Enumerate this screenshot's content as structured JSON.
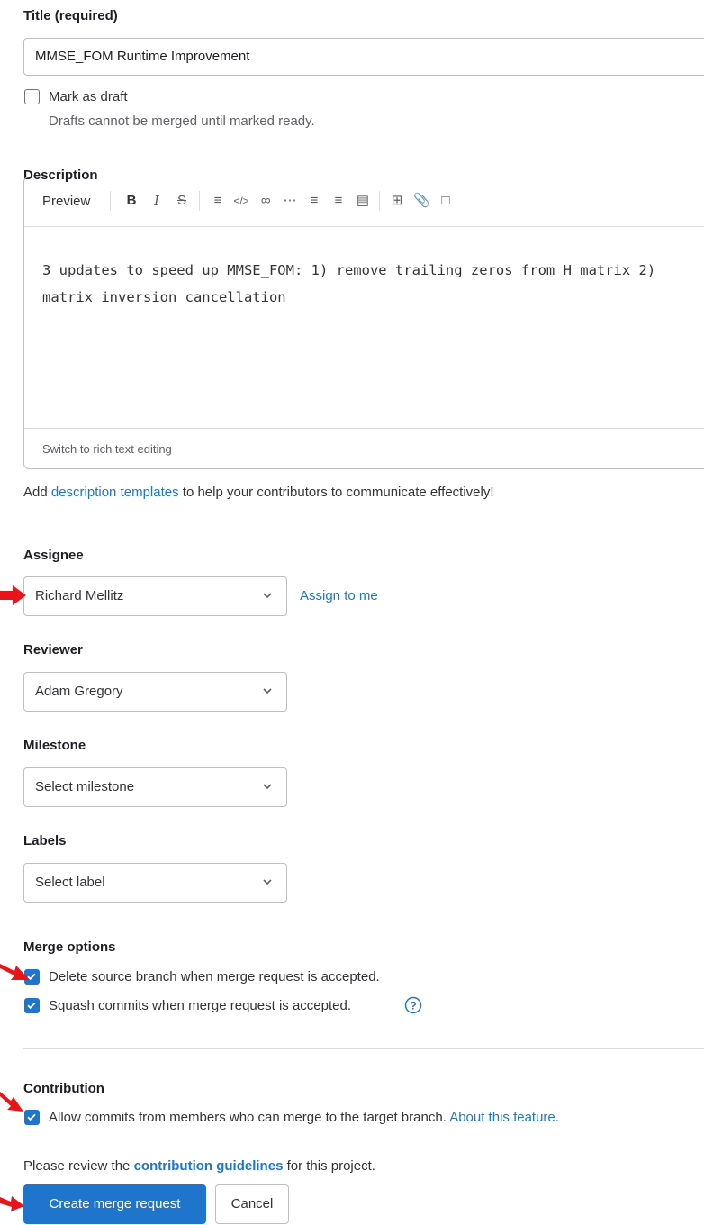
{
  "title_field": {
    "label": "Title (required)",
    "value": "MMSE_FOM Runtime Improvement"
  },
  "draft": {
    "label": "Mark as draft",
    "help": "Drafts cannot be merged until marked ready.",
    "checked": false
  },
  "description": {
    "label": "Description",
    "toolbar": {
      "preview_label": "Preview",
      "icons": [
        "bold-icon",
        "italic-icon",
        "strikethrough-icon",
        "quote-icon",
        "code-icon",
        "link-icon",
        "bullet-list-icon",
        "numbered-list-icon",
        "task-list-icon",
        "collapsible-icon",
        "table-icon",
        "attachment-icon",
        "quick-actions-icon"
      ]
    },
    "text": "3 updates to speed up MMSE_FOM: 1) remove trailing zeros from H matrix 2)\nmatrix inversion cancellation",
    "footer_link": "Switch to rich text editing",
    "templates_pre": "Add ",
    "templates_link": "description templates",
    "templates_post": " to help your contributors to communicate effectively!"
  },
  "assignee": {
    "label": "Assignee",
    "value": "Richard Mellitz",
    "assign_to_me": "Assign to me"
  },
  "reviewer": {
    "label": "Reviewer",
    "value": "Adam Gregory"
  },
  "milestone": {
    "label": "Milestone",
    "value": "Select milestone"
  },
  "labels": {
    "label": "Labels",
    "value": "Select label"
  },
  "merge_options": {
    "label": "Merge options",
    "delete_branch": {
      "label": "Delete source branch when merge request is accepted.",
      "checked": true
    },
    "squash": {
      "label": "Squash commits when merge request is accepted.",
      "checked": true
    }
  },
  "contribution": {
    "label": "Contribution",
    "allow_commits": {
      "label": "Allow commits from members who can merge to the target branch.",
      "link": "About this feature.",
      "checked": true
    }
  },
  "guidelines": {
    "pre": "Please review the ",
    "link": "contribution guidelines",
    "post": " for this project."
  },
  "actions": {
    "create_label": "Create merge request",
    "cancel_label": "Cancel"
  },
  "colors": {
    "accent": "#1f75cb",
    "annotation_arrow": "#e8141b"
  }
}
